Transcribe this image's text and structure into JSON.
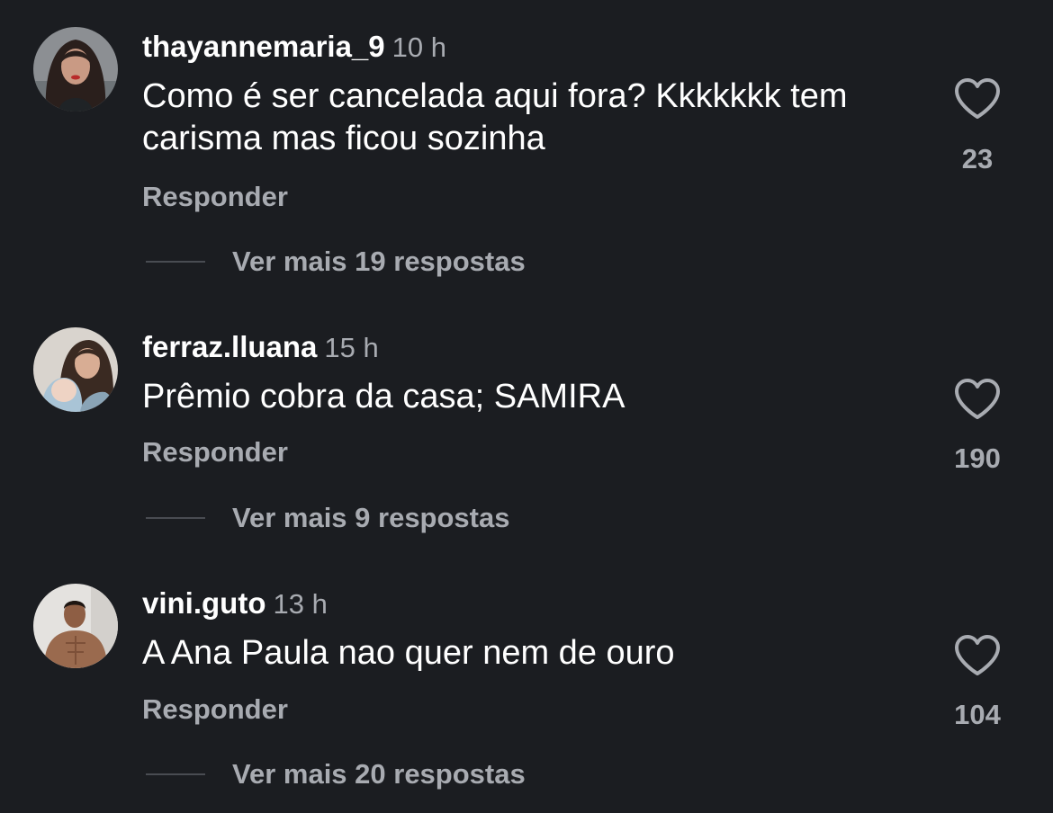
{
  "comments": [
    {
      "username": "thayannemaria_9",
      "time": "10 h",
      "text": "Como é ser cancelada aqui fora? Kkkkkkk tem carisma mas ficou sozinha",
      "reply_label": "Responder",
      "view_replies": "Ver mais 19 respostas",
      "likes": "23",
      "avatar_icon": "avatar-dark-hair-woman"
    },
    {
      "username": "ferraz.lluana",
      "time": "15 h",
      "text": "Prêmio cobra da casa; SAMIRA",
      "reply_label": "Responder",
      "view_replies": "Ver mais 9 respostas",
      "likes": "190",
      "avatar_icon": "avatar-woman-with-baby"
    },
    {
      "username": "vini.guto",
      "time": "13 h",
      "text": "A Ana Paula nao quer nem de ouro",
      "reply_label": "Responder",
      "view_replies": "Ver mais 20 respostas",
      "likes": "104",
      "avatar_icon": "avatar-shirtless-man"
    }
  ],
  "colors": {
    "background": "#1b1d21",
    "primary_text": "#ffffff",
    "secondary_text": "#a8abb1",
    "divider": "#494c52"
  }
}
